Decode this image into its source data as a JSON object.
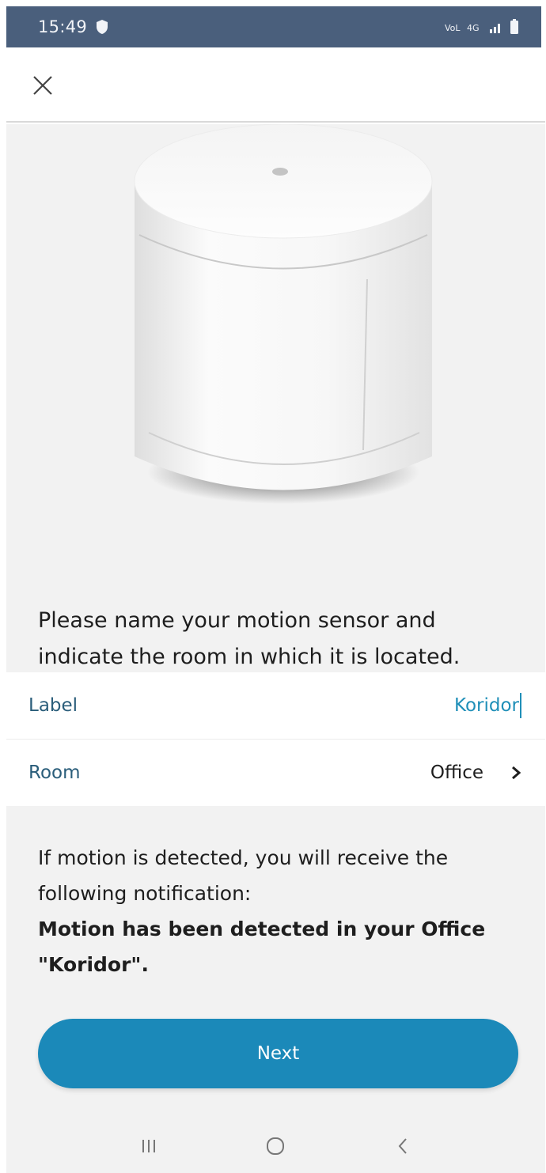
{
  "status_bar": {
    "time": "15:49",
    "icons": [
      "shield-icon",
      "volte1-icon",
      "volte2-icon",
      "signal-icon",
      "battery-icon"
    ]
  },
  "top_bar": {
    "close_icon": "close-icon"
  },
  "device": {
    "image": "motion-sensor-device"
  },
  "instruction": "Please name your motion sensor and indicate the room in which it is located.",
  "form": {
    "label": {
      "label": "Label",
      "value": "Koridor"
    },
    "room": {
      "label": "Room",
      "value": "Office",
      "icon": "chevron-right-icon"
    }
  },
  "notice": {
    "text": "If motion is detected, you will receive the following notification:",
    "example": "Motion has been detected in your Office \"Koridor\"."
  },
  "next_button": {
    "label": "Next"
  },
  "nav_bar": {
    "icons": [
      "recents-icon",
      "home-icon",
      "back-icon"
    ]
  },
  "colors": {
    "status_bar": "#4a5f7c",
    "accent": "#1b89b9",
    "label_text": "#2a5d7a",
    "background": "#f2f2f2"
  }
}
